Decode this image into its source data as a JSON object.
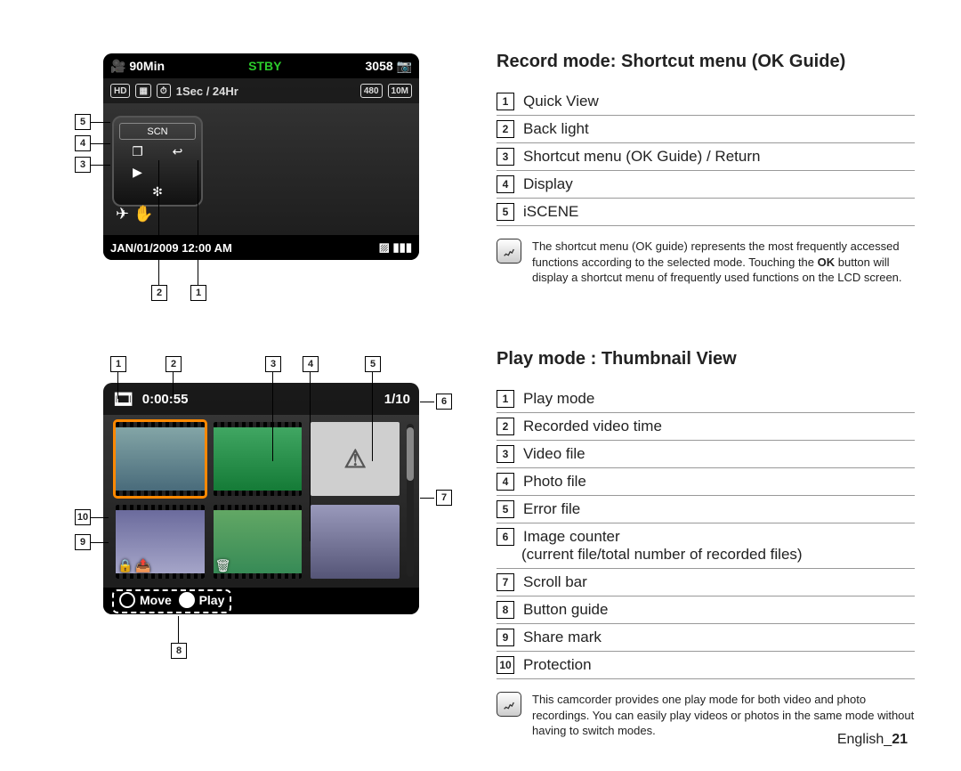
{
  "section1": {
    "title": "Record mode: Shortcut menu (OK Guide)",
    "items": [
      {
        "n": "1",
        "label": "Quick View"
      },
      {
        "n": "2",
        "label": "Back light"
      },
      {
        "n": "3",
        "label": "Shortcut menu (OK Guide) / Return"
      },
      {
        "n": "4",
        "label": "Display"
      },
      {
        "n": "5",
        "label": "iSCENE"
      }
    ],
    "note": "The shortcut menu (OK guide) represents the most frequently accessed functions according to the selected mode. Touching the OK button will display a shortcut menu of frequently used functions on the LCD screen."
  },
  "section2": {
    "title": "Play mode : Thumbnail View",
    "items": [
      {
        "n": "1",
        "label": "Play mode"
      },
      {
        "n": "2",
        "label": "Recorded video time"
      },
      {
        "n": "3",
        "label": "Video file"
      },
      {
        "n": "4",
        "label": "Photo file"
      },
      {
        "n": "5",
        "label": "Error file"
      },
      {
        "n": "6",
        "label": "Image counter",
        "sub": "(current file/total number of recorded files)"
      },
      {
        "n": "7",
        "label": "Scroll bar"
      },
      {
        "n": "8",
        "label": "Button guide"
      },
      {
        "n": "9",
        "label": "Share mark"
      },
      {
        "n": "10",
        "label": "Protection"
      }
    ],
    "note": "This camcorder provides one play mode for both video and photo recordings. You can easily play videos or photos in the same mode without having to switch modes."
  },
  "lcd1": {
    "rec_time": "90Min",
    "status": "STBY",
    "shots": "3058",
    "interval": "1Sec / 24Hr",
    "res_tag": "480",
    "mp_tag": "10M",
    "hd_tag": "HD",
    "datetime": "JAN/01/2009 12:00 AM"
  },
  "lcd2": {
    "elapsed": "0:00:55",
    "counter": "1/10",
    "move": "Move",
    "play": "Play"
  },
  "markers": {
    "lcd1_left": [
      "5",
      "4",
      "3"
    ],
    "lcd1_bottom": [
      "2",
      "1"
    ],
    "lcd2_top": [
      "1",
      "2",
      "3",
      "4",
      "5"
    ],
    "lcd2_right": [
      "6",
      "7"
    ],
    "lcd2_left": [
      "10",
      "9"
    ],
    "lcd2_bottom": [
      "8"
    ]
  },
  "footer": {
    "lang": "English",
    "page": "21"
  }
}
